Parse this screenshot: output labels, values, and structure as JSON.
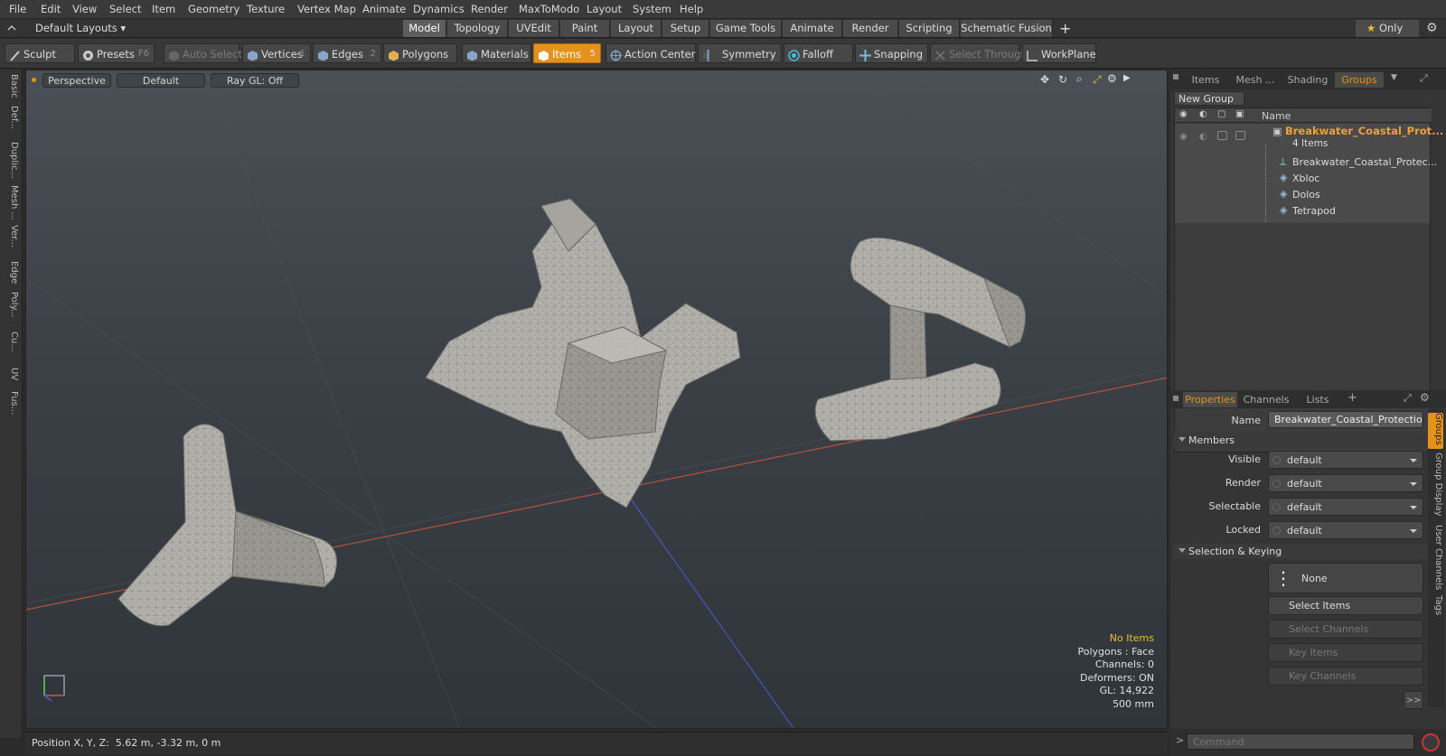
{
  "menu": [
    "File",
    "Edit",
    "View",
    "Select",
    "Item",
    "Geometry",
    "Texture",
    "Vertex Map",
    "Animate",
    "Dynamics",
    "Render",
    "MaxToModo",
    "Layout",
    "System",
    "Help"
  ],
  "layout_selector": "Default Layouts",
  "layout_tabs": [
    "Model",
    "Topology",
    "UVEdit",
    "Paint",
    "Layout",
    "Setup",
    "Game Tools",
    "Animate",
    "Render",
    "Scripting",
    "Schematic Fusion"
  ],
  "only_label": "Only",
  "toolbar": {
    "sculpt": "Sculpt",
    "presets": "Presets",
    "presets_shortcut": "F6",
    "auto_select": "Auto Select",
    "vertices": "Vertices",
    "vertices_shortcut": "1",
    "edges": "Edges",
    "edges_shortcut": "2",
    "polygons": "Polygons",
    "materials": "Materials",
    "items": "Items",
    "items_shortcut": "5",
    "action_center": "Action Center",
    "symmetry": "Symmetry",
    "falloff": "Falloff",
    "snapping": "Snapping",
    "select_through": "Select Through",
    "workplane": "WorkPlane"
  },
  "left_tabs": [
    "Basic",
    "Def...",
    "Duplic...",
    "Mesh ...",
    "Ver...",
    "Edge",
    "Poly...",
    "Cu...",
    "UV",
    "Fus..."
  ],
  "viewport": {
    "view": "Perspective",
    "shading": "Default",
    "raygl": "Ray GL: Off",
    "info": {
      "no_items": "No Items",
      "polygons": "Polygons : Face",
      "channels": "Channels: 0",
      "deformers": "Deformers: ON",
      "gl": "GL: 14,922",
      "scale": "500 mm"
    }
  },
  "status": {
    "position": "Position X, Y, Z:  5.62 m, -3.32 m, 0 m"
  },
  "right_tabs": [
    "Items",
    "Mesh ...",
    "Shading",
    "Groups"
  ],
  "groups": {
    "new_group": "New Group",
    "name_header": "Name",
    "group_name": "Breakwater_Coastal_Prot...",
    "group_count": "4 Items",
    "members": [
      "Breakwater_Coastal_Protec...",
      "Xbloc",
      "Dolos",
      "Tetrapod"
    ]
  },
  "props_tabs": [
    "Properties",
    "Channels",
    "Lists"
  ],
  "properties": {
    "name_label": "Name",
    "name_value": "Breakwater_Coastal_Protection_I",
    "members_section": "Members",
    "visible_label": "Visible",
    "visible_value": "default",
    "render_label": "Render",
    "render_value": "default",
    "selectable_label": "Selectable",
    "selectable_value": "default",
    "locked_label": "Locked",
    "locked_value": "default",
    "sel_section": "Selection & Keying",
    "none_btn": "None",
    "select_items": "Select Items",
    "select_channels": "Select Channels",
    "key_items": "Key Items",
    "key_channels": "Key Channels",
    "more": ">>"
  },
  "side_vtabs": [
    "Groups",
    "Group Display",
    "User Channels",
    "Tags"
  ],
  "command_placeholder": "Command",
  "colors": {
    "accent": "#e5921d",
    "viewport_top": "#4a5056",
    "viewport_bottom": "#30353a"
  }
}
